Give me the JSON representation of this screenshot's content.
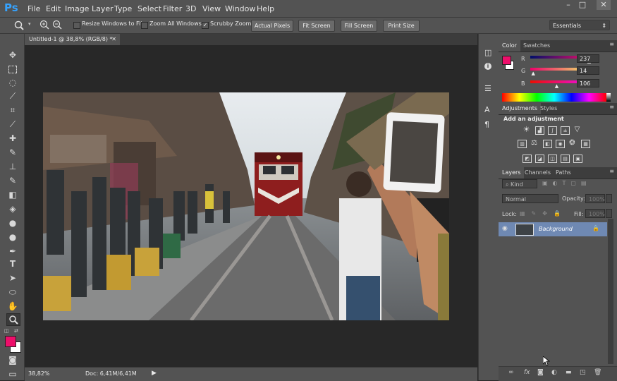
{
  "app": {
    "logo": "Ps"
  },
  "menu": [
    "File",
    "Edit",
    "Image",
    "Layer",
    "Type",
    "Select",
    "Filter",
    "3D",
    "View",
    "Window",
    "Help"
  ],
  "window_controls": [
    "–",
    "□",
    "✕"
  ],
  "options": {
    "zoom_tool_icon": "zoom-icon",
    "resize_windows_label": "Resize Windows to Fit",
    "zoom_all_label": "Zoom All Windows",
    "scrubby_label": "Scrubby Zoom",
    "scrubby_checked": true,
    "actual_pixels": "Actual Pixels",
    "fit_screen": "Fit Screen",
    "fill_screen": "Fill Screen",
    "print_size": "Print Size",
    "workspace": "Essentials"
  },
  "document": {
    "tab_title": "Untitled-1 @ 38,8% (RGB/8) *",
    "zoom": "38,82%",
    "doc_info": "Doc: 6,41M/6,41M"
  },
  "colors": {
    "foreground": "#ed0e6a",
    "background": "#ffffff"
  },
  "color_panel": {
    "tabs": [
      "Color",
      "Swatches"
    ],
    "channels": [
      {
        "label": "R",
        "value": "237",
        "fraction": 0.93
      },
      {
        "label": "G",
        "value": "14",
        "fraction": 0.05
      },
      {
        "label": "B",
        "value": "106",
        "fraction": 0.42
      }
    ]
  },
  "adjustments_panel": {
    "tabs": [
      "Adjustments",
      "Styles"
    ],
    "heading": "Add an adjustment",
    "row1": [
      "brightness-icon",
      "levels-icon",
      "curves-icon",
      "exposure-icon",
      "vibrance-icon"
    ],
    "row2": [
      "hue-saturation-icon",
      "color-balance-icon",
      "black-white-icon",
      "photo-filter-icon",
      "channel-mixer-icon",
      "color-lookup-icon"
    ],
    "row3": [
      "invert-icon",
      "posterize-icon",
      "threshold-icon",
      "gradient-map-icon",
      "selective-color-icon"
    ]
  },
  "layers_panel": {
    "tabs": [
      "Layers",
      "Channels",
      "Paths"
    ],
    "filter_kind": "Kind",
    "blend_mode": "Normal",
    "opacity_label": "Opacity:",
    "opacity_value": "100%",
    "lock_label": "Lock:",
    "fill_label": "Fill:",
    "fill_value": "100%",
    "layers": [
      {
        "name": "Background",
        "visible": true,
        "locked": true
      }
    ],
    "footer_icons": [
      "link-icon",
      "fx-icon",
      "mask-icon",
      "adjustment-layer-icon",
      "folder-icon",
      "new-layer-icon",
      "trash-icon"
    ]
  }
}
